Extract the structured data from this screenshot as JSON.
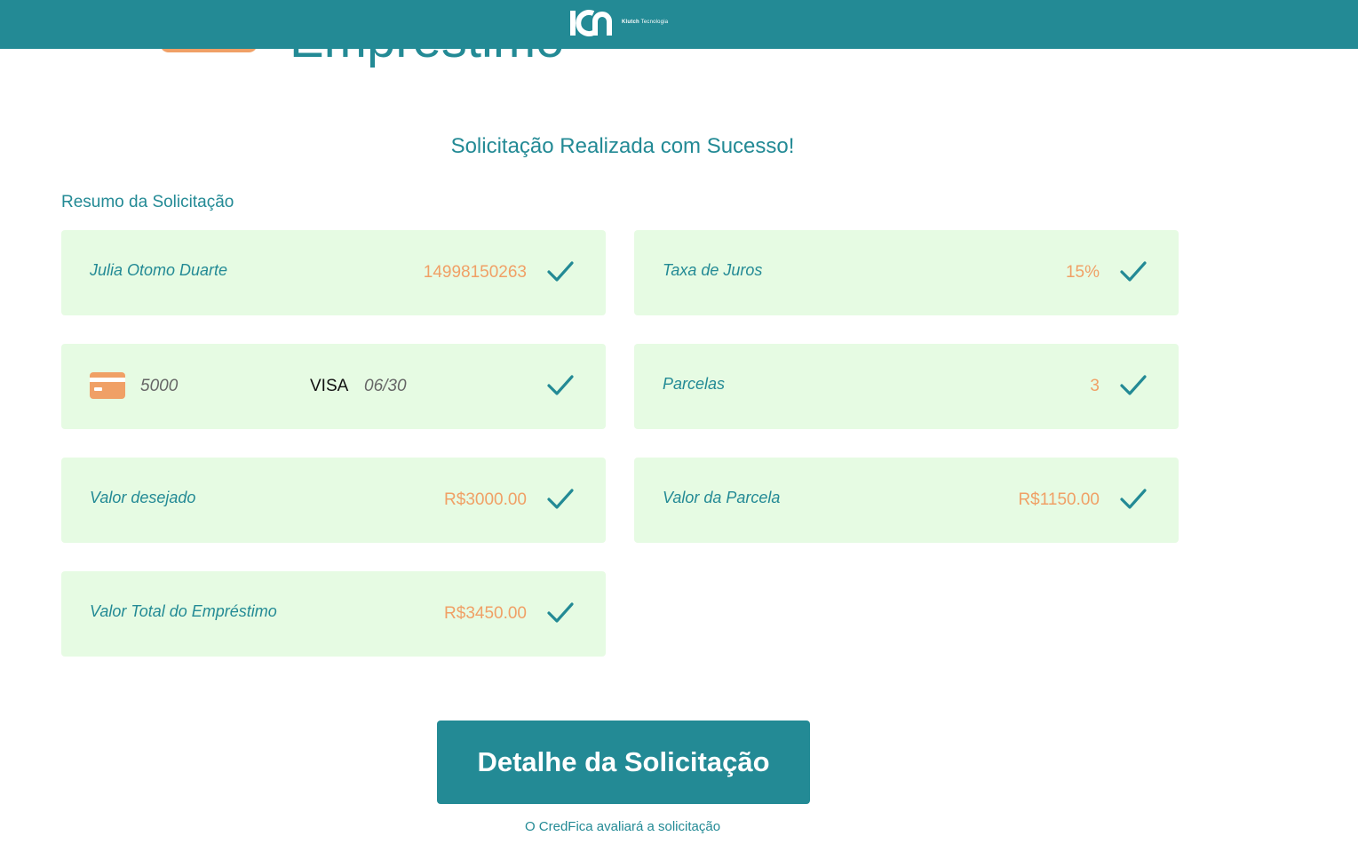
{
  "header": {
    "logo_icon": "klutch-logo-icon",
    "brand_name": "Klutch",
    "brand_suffix": "Tecnologia",
    "background_color": "#238a95"
  },
  "hero": {
    "title": "Empréstimo"
  },
  "success_title": "Solicitação Realizada com Sucesso!",
  "summary_label": "Resumo da Solicitação",
  "summary": {
    "client": {
      "label": "Julia Otomo Duarte",
      "value": "14998150263"
    },
    "interest": {
      "label": "Taxa de Juros",
      "value": "15%"
    },
    "card": {
      "icon": "credit-card-icon",
      "number": "5000",
      "brand": "VISA",
      "expiry": "06/30"
    },
    "installments": {
      "label": "Parcelas",
      "value": "3"
    },
    "desired_amount": {
      "label": "Valor desejado",
      "value": "R$3000.00"
    },
    "installment_amount": {
      "label": "Valor da Parcela",
      "value": "R$1150.00"
    },
    "total_amount": {
      "label": "Valor Total do Empréstimo",
      "value": "R$3450.00"
    }
  },
  "detail_button_label": "Detalhe da Solicitação",
  "footer_note": "O CredFica avaliará a solicitação",
  "colors": {
    "primary": "#238a95",
    "accent": "#f0a066",
    "card_background": "#e6fbe3"
  }
}
